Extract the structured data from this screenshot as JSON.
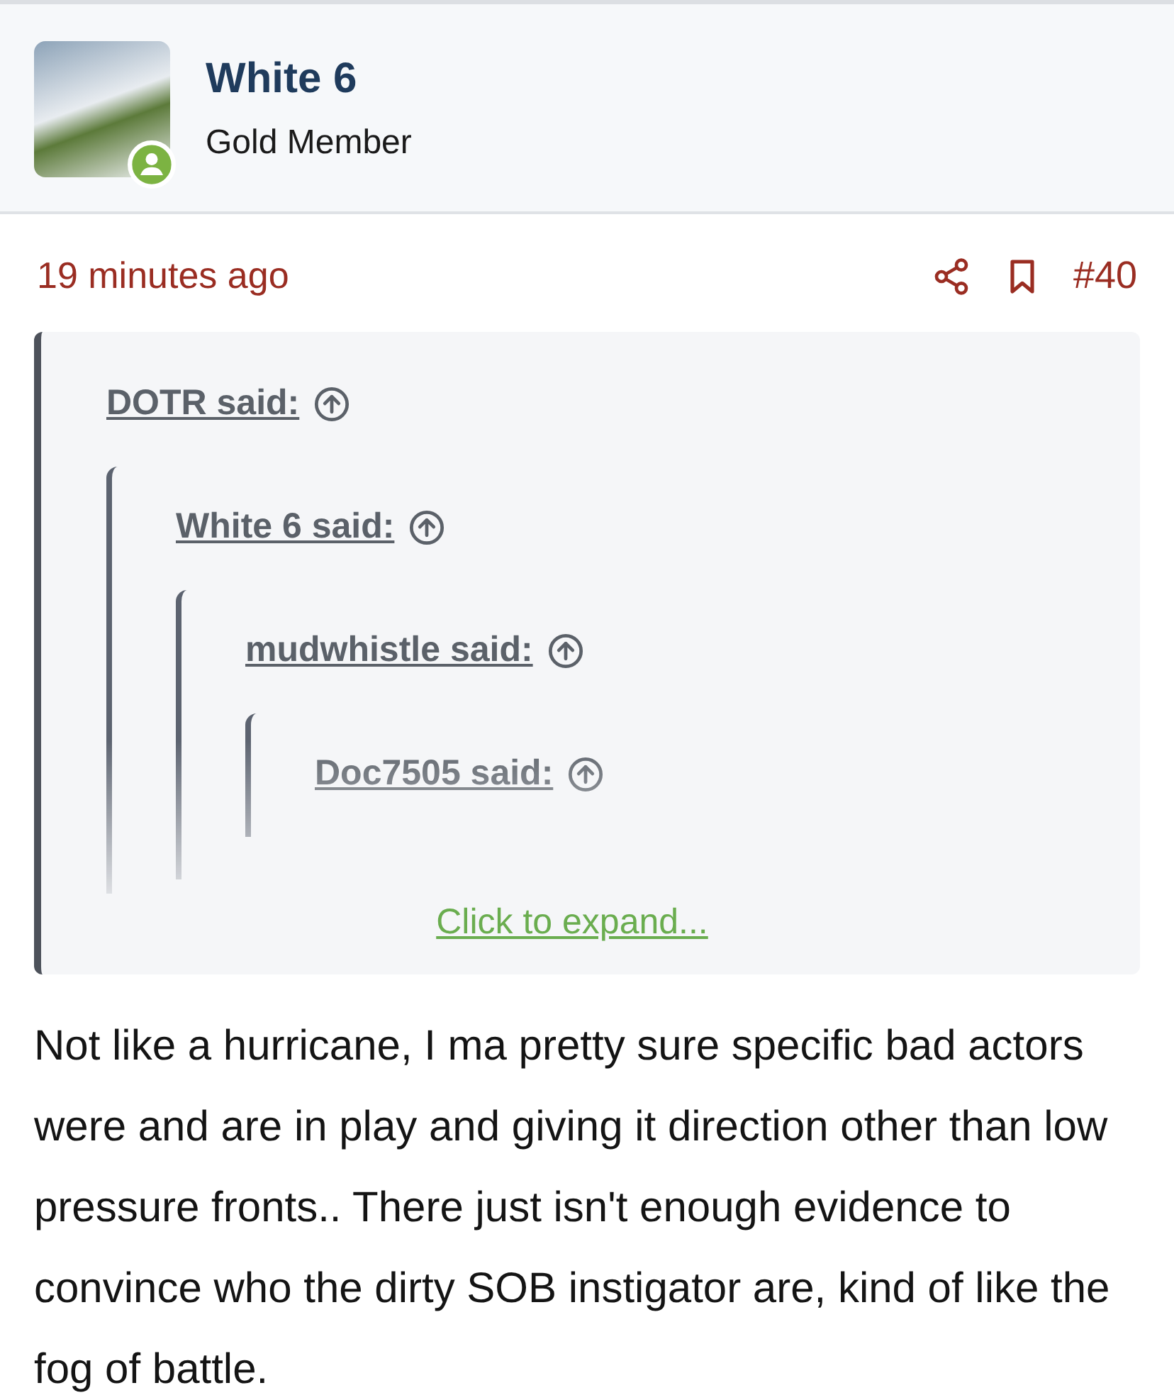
{
  "user": {
    "name": "White 6",
    "title": "Gold Member",
    "online": true
  },
  "post": {
    "time": "19 minutes ago",
    "number": "#40"
  },
  "quote": {
    "expanded": false,
    "expand_link": "Click to expand...",
    "nested": {
      "author": "DOTR said:",
      "children": [
        {
          "author": "White 6 said:",
          "children": [
            {
              "author": "mudwhistle said:",
              "children": [
                {
                  "author": "Doc7505 said:"
                }
              ]
            }
          ]
        }
      ]
    }
  },
  "body": "Not like a hurricane, I ma pretty sure specific bad actors were and are in play and giving it direction other than low pressure fronts.. There just isn't enough evidence to convince who the dirty SOB instigator are, kind of like the fog of battle."
}
